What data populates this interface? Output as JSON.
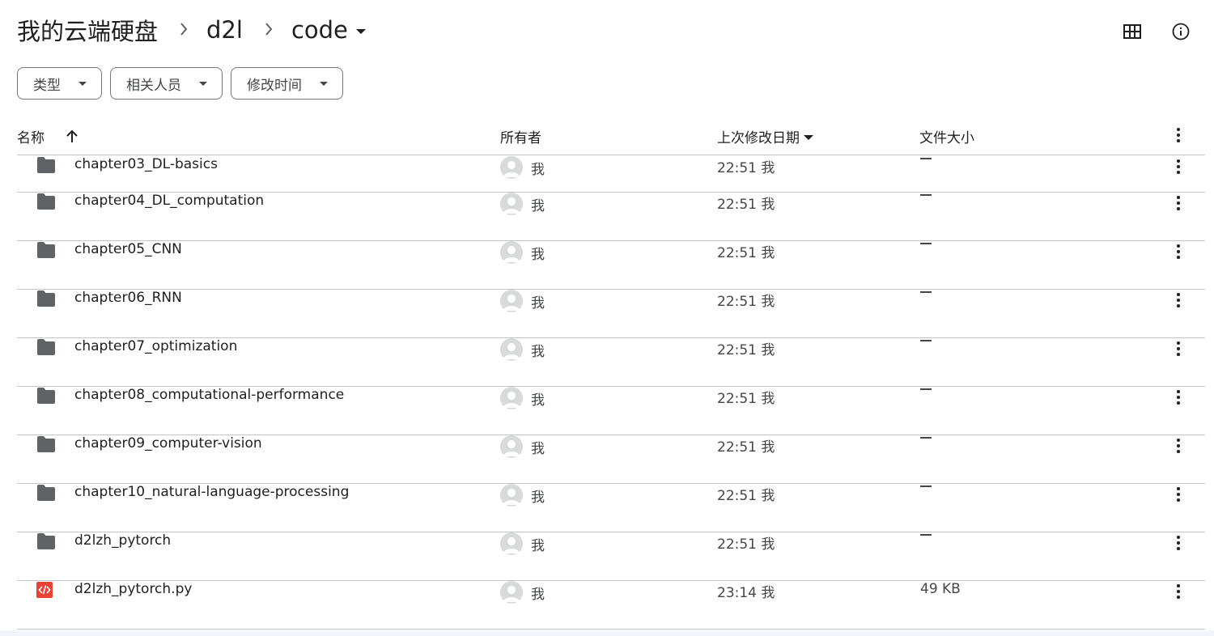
{
  "breadcrumb": {
    "root": "我的云端硬盘",
    "parent": "d2l",
    "current": "code"
  },
  "filters": {
    "type": "类型",
    "people": "相关人员",
    "modified": "修改时间"
  },
  "table_header": {
    "name": "名称",
    "owner": "所有者",
    "modified": "上次修改日期",
    "size": "文件大小"
  },
  "rows": [
    {
      "icon": "folder-icon",
      "name": "chapter03_DL-basics",
      "owner": "我",
      "modified": "22:51 我",
      "size": "—"
    },
    {
      "icon": "folder-icon",
      "name": "chapter04_DL_computation",
      "owner": "我",
      "modified": "22:51 我",
      "size": "—"
    },
    {
      "icon": "folder-icon",
      "name": "chapter05_CNN",
      "owner": "我",
      "modified": "22:51 我",
      "size": "—"
    },
    {
      "icon": "folder-icon",
      "name": "chapter06_RNN",
      "owner": "我",
      "modified": "22:51 我",
      "size": "—"
    },
    {
      "icon": "folder-icon",
      "name": "chapter07_optimization",
      "owner": "我",
      "modified": "22:51 我",
      "size": "—"
    },
    {
      "icon": "folder-icon",
      "name": "chapter08_computational-performance",
      "owner": "我",
      "modified": "22:51 我",
      "size": "—"
    },
    {
      "icon": "folder-icon",
      "name": "chapter09_computer-vision",
      "owner": "我",
      "modified": "22:51 我",
      "size": "—"
    },
    {
      "icon": "folder-icon",
      "name": "chapter10_natural-language-processing",
      "owner": "我",
      "modified": "22:51 我",
      "size": "—"
    },
    {
      "icon": "folder-icon",
      "name": "d2lzh_pytorch",
      "owner": "我",
      "modified": "22:51 我",
      "size": "—"
    },
    {
      "icon": "code-file-icon",
      "name": "d2lzh_pytorch.py",
      "owner": "我",
      "modified": "23:14 我",
      "size": "49 KB"
    }
  ],
  "colors": {
    "folder": "#5f6368",
    "code_file": "#ea4335",
    "divider": "#c4c7c5",
    "avatar_bg": "#d9dadc"
  }
}
